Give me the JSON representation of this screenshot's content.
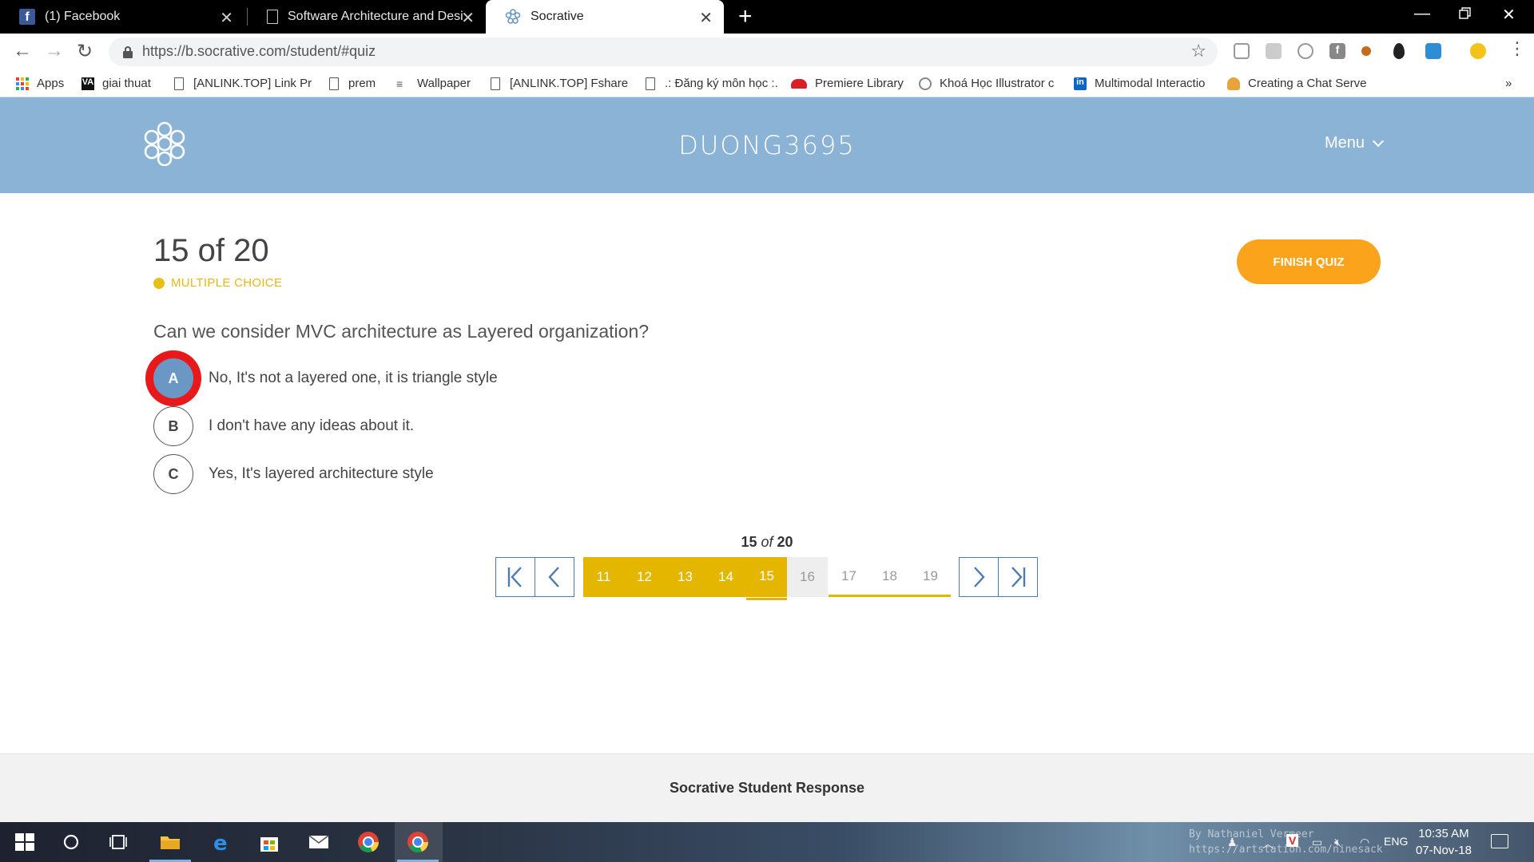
{
  "browser": {
    "tabs": [
      {
        "title": "(1) Facebook"
      },
      {
        "title": "Software Architecture and Desig"
      },
      {
        "title": "Socrative"
      }
    ],
    "url": "https://b.socrative.com/student/#quiz",
    "bookmarks": [
      "Apps",
      "giai thuat",
      "[ANLINK.TOP] Link Pr",
      "prem",
      "Wallpaper",
      "[ANLINK.TOP] Fshare",
      ".: Đăng ký môn học :.",
      "Premiere Library",
      "Khoá Học Illustrator c",
      "Multimodal Interactio",
      "Creating a Chat Serve"
    ],
    "bookmarks_overflow": "»"
  },
  "header": {
    "room_name": "DUONG3695",
    "menu_label": "Menu"
  },
  "quiz": {
    "progress": "15 of 20",
    "type_label": "MULTIPLE CHOICE",
    "finish_label": "FINISH QUIZ",
    "question": "Can we consider MVC architecture as Layered organization?",
    "answers": [
      {
        "letter": "A",
        "text": "No, It's not a layered one, it is triangle style",
        "selected": true
      },
      {
        "letter": "B",
        "text": "I don't have any ideas about it.",
        "selected": false
      },
      {
        "letter": "C",
        "text": "Yes, It's layered architecture style",
        "selected": false
      }
    ]
  },
  "pagination": {
    "current": "15",
    "of": "of",
    "total": "20",
    "pages": [
      {
        "label": "11",
        "state": "answered"
      },
      {
        "label": "12",
        "state": "answered"
      },
      {
        "label": "13",
        "state": "answered"
      },
      {
        "label": "14",
        "state": "answered"
      },
      {
        "label": "15",
        "state": "answered-current"
      },
      {
        "label": "16",
        "state": "unanswered-current"
      },
      {
        "label": "17",
        "state": "unanswered"
      },
      {
        "label": "18",
        "state": "unanswered"
      },
      {
        "label": "19",
        "state": "unanswered"
      }
    ]
  },
  "footer": {
    "text": "Socrative Student Response"
  },
  "taskbar": {
    "time": "10:35 AM",
    "date": "07-Nov-18",
    "language": "ENG",
    "watermark_line1": "By Nathaniel Vermeer",
    "watermark_line2": "https://artstation.com/ninesack"
  },
  "colors": {
    "header_blue": "#8bb3d5",
    "answered_yellow": "#e5b600",
    "finish_orange": "#fba31a",
    "selection_red": "#e8191b",
    "selected_blue": "#6b97c4"
  }
}
